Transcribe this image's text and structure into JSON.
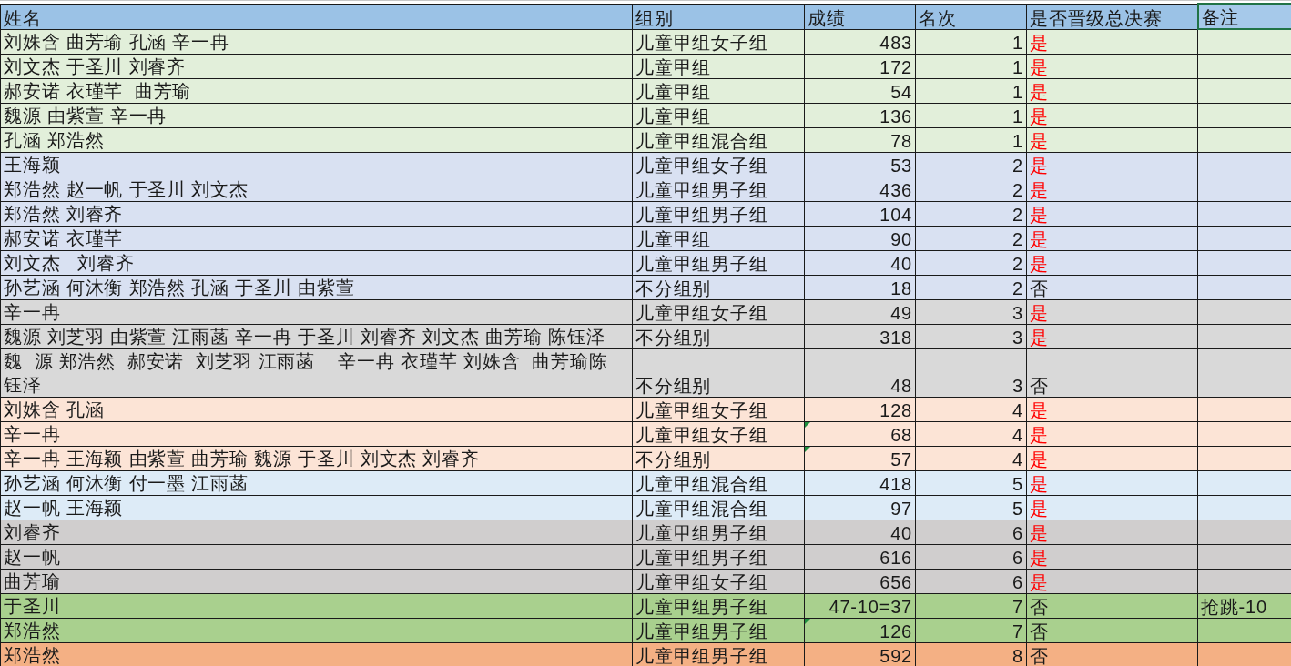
{
  "table": {
    "columns": [
      {
        "label": "姓名",
        "selected": false
      },
      {
        "label": "组别",
        "selected": false
      },
      {
        "label": "成绩",
        "selected": false
      },
      {
        "label": "名次",
        "selected": false
      },
      {
        "label": "是否晋级总决赛",
        "selected": false
      },
      {
        "label": "备注",
        "selected": true
      }
    ],
    "rows": [
      {
        "name": "刘姝含 曲芳瑜 孔涵 辛一冉",
        "group": "儿童甲组女子组",
        "score": "483",
        "rank": "1",
        "advance": "是",
        "advanced": true,
        "flagged": false,
        "color": "#e2efda"
      },
      {
        "name": "刘文杰 于圣川 刘睿齐",
        "group": "儿童甲组",
        "score": "172",
        "rank": "1",
        "advance": "是",
        "advanced": true,
        "flagged": false,
        "color": "#e2efda"
      },
      {
        "name": "郝安诺 衣瑾芊  曲芳瑜",
        "group": "儿童甲组",
        "score": "54",
        "rank": "1",
        "advance": "是",
        "advanced": true,
        "flagged": false,
        "color": "#e2efda"
      },
      {
        "name": "魏源 由紫萱 辛一冉",
        "group": "儿童甲组",
        "score": "136",
        "rank": "1",
        "advance": "是",
        "advanced": true,
        "flagged": false,
        "color": "#e2efda"
      },
      {
        "name": "孔涵 郑浩然",
        "group": "儿童甲组混合组",
        "score": "78",
        "rank": "1",
        "advance": "是",
        "advanced": true,
        "flagged": false,
        "color": "#e2efda"
      },
      {
        "name": "王海颖",
        "group": "儿童甲组女子组",
        "score": "53",
        "rank": "2",
        "advance": "是",
        "advanced": true,
        "flagged": false,
        "color": "#d9e1f2"
      },
      {
        "name": "郑浩然 赵一帆 于圣川 刘文杰",
        "group": "儿童甲组男子组",
        "score": "436",
        "rank": "2",
        "advance": "是",
        "advanced": true,
        "flagged": false,
        "color": "#d9e1f2"
      },
      {
        "name": "郑浩然 刘睿齐",
        "group": "儿童甲组男子组",
        "score": "104",
        "rank": "2",
        "advance": "是",
        "advanced": true,
        "flagged": false,
        "color": "#d9e1f2"
      },
      {
        "name": "郝安诺 衣瑾芊",
        "group": "儿童甲组",
        "score": "90",
        "rank": "2",
        "advance": "是",
        "advanced": true,
        "flagged": false,
        "color": "#d9e1f2"
      },
      {
        "name": "刘文杰   刘睿齐",
        "group": "儿童甲组男子组",
        "score": "40",
        "rank": "2",
        "advance": "是",
        "advanced": true,
        "flagged": false,
        "color": "#d9e1f2"
      },
      {
        "name": "孙艺涵 何沐衡 郑浩然 孔涵 于圣川 由紫萱",
        "group": "不分组别",
        "score": "18",
        "rank": "2",
        "advance": "否",
        "advanced": false,
        "flagged": false,
        "color": "#d9e1f2"
      },
      {
        "name": "辛一冉",
        "group": "儿童甲组女子组",
        "score": "49",
        "rank": "3",
        "advance": "是",
        "advanced": true,
        "flagged": false,
        "color": "#d9d9d9"
      },
      {
        "name": "魏源 刘芝羽 由紫萱 江雨菡 辛一冉 于圣川 刘睿齐 刘文杰 曲芳瑜 陈钰泽",
        "group": "不分组别",
        "score": "318",
        "rank": "3",
        "advance": "是",
        "advanced": true,
        "flagged": false,
        "color": "#d9d9d9"
      },
      {
        "name": "魏  源 郑浩然  郝安诺  刘芝羽 江雨菡    辛一冉 衣瑾芊 刘姝含  曲芳瑜陈钰泽",
        "group": "不分组别",
        "score": "48",
        "rank": "3",
        "advance": "否",
        "advanced": false,
        "flagged": false,
        "color": "#d9d9d9"
      },
      {
        "name": "刘姝含 孔涵",
        "group": "儿童甲组女子组",
        "score": "128",
        "rank": "4",
        "advance": "是",
        "advanced": true,
        "flagged": false,
        "color": "#fce4d6"
      },
      {
        "name": "辛一冉",
        "group": "儿童甲组女子组",
        "score": "68",
        "rank": "4",
        "advance": "是",
        "advanced": true,
        "flagged": true,
        "color": "#fce4d6"
      },
      {
        "name": "辛一冉 王海颖 由紫萱 曲芳瑜 魏源 于圣川 刘文杰 刘睿齐",
        "group": "不分组别",
        "score": "57",
        "rank": "4",
        "advance": "是",
        "advanced": true,
        "flagged": true,
        "color": "#fce4d6"
      },
      {
        "name": "孙艺涵 何沐衡 付一墨 江雨菡",
        "group": "儿童甲组混合组",
        "score": "418",
        "rank": "5",
        "advance": "是",
        "advanced": true,
        "flagged": false,
        "color": "#ddebf7"
      },
      {
        "name": "赵一帆 王海颖",
        "group": "儿童甲组混合组",
        "score": "97",
        "rank": "5",
        "advance": "是",
        "advanced": true,
        "flagged": false,
        "color": "#ddebf7"
      },
      {
        "name": "刘睿齐",
        "group": "儿童甲组男子组",
        "score": "40",
        "rank": "6",
        "advance": "是",
        "advanced": true,
        "flagged": false,
        "color": "#d0cece"
      },
      {
        "name": "赵一帆",
        "group": "儿童甲组男子组",
        "score": "616",
        "rank": "6",
        "advance": "是",
        "advanced": true,
        "flagged": false,
        "color": "#d0cece"
      },
      {
        "name": "曲芳瑜",
        "group": "儿童甲组女子组",
        "score": "656",
        "rank": "6",
        "advance": "是",
        "advanced": true,
        "flagged": false,
        "color": "#d0cece"
      },
      {
        "name": "于圣川",
        "group": "儿童甲组男子组",
        "score": "47-10=37",
        "rank": "7",
        "advance": "否",
        "advanced": false,
        "remark": "抢跳-10",
        "flagged": false,
        "color": "#a9d08e"
      },
      {
        "name": "郑浩然",
        "group": "儿童甲组男子组",
        "score": "126",
        "rank": "7",
        "advance": "否",
        "advanced": false,
        "flagged": true,
        "color": "#a9d08e"
      },
      {
        "name": "郑浩然",
        "group": "儿童甲组男子组",
        "score": "592",
        "rank": "8",
        "advance": "否",
        "advanced": false,
        "flagged": false,
        "color": "#f4b084"
      }
    ]
  }
}
